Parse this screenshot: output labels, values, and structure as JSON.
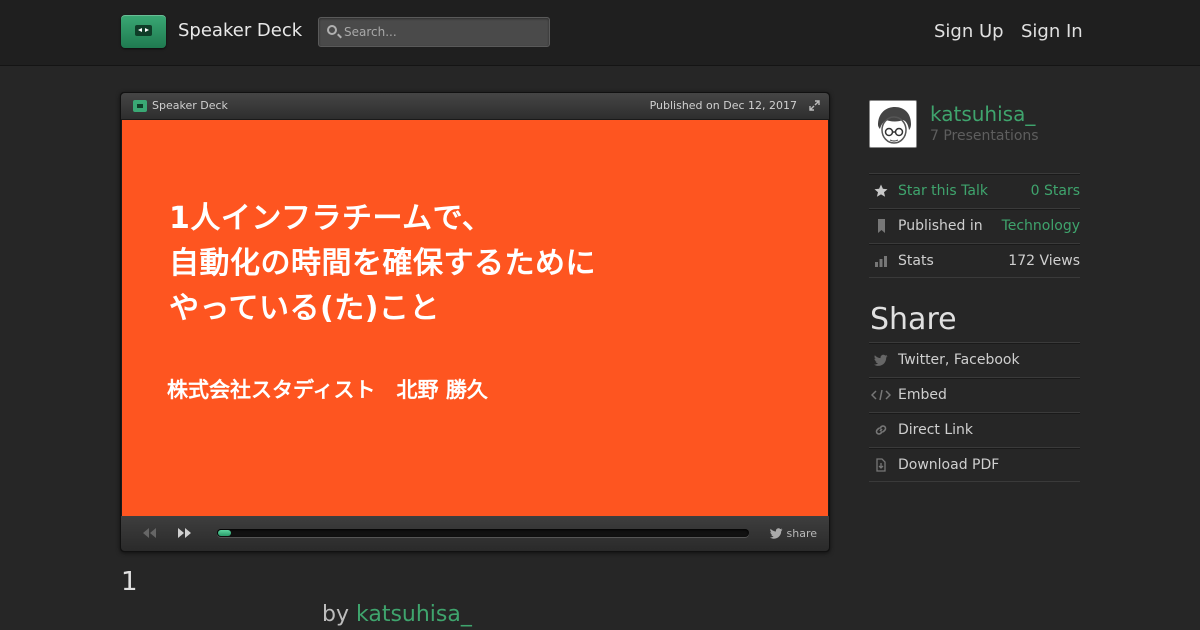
{
  "header": {
    "brand": "Speaker Deck",
    "search_placeholder": "Search...",
    "sign_up": "Sign Up",
    "sign_in": "Sign In"
  },
  "player": {
    "brand": "Speaker Deck",
    "published": "Published on Dec 12, 2017",
    "slide": {
      "title_lines": [
        "1人インフラチームで、",
        "自動化の時間を確保するために",
        "やっている(た)こと"
      ],
      "author": "株式会社スタディスト　北野 勝久",
      "background": "#fe5520"
    },
    "controls": {
      "progress_fraction": 0.025,
      "share_label": "share"
    }
  },
  "below_player": {
    "slide_number": "1",
    "by_prefix": "by",
    "author": "katsuhisa_"
  },
  "sidebar": {
    "author_name": "katsuhisa_",
    "presentations": "7 Presentations",
    "rows": [
      {
        "icon": "star-icon",
        "label": "Star this Talk",
        "value": "0 Stars"
      },
      {
        "icon": "bookmark-icon",
        "label": "Published in",
        "value": "Technology"
      },
      {
        "icon": "bar-chart-icon",
        "label": "Stats",
        "value": "172 Views"
      }
    ],
    "share_heading": "Share",
    "share_rows": [
      {
        "icon": "twitter-bird-icon",
        "label": "Twitter, Facebook"
      },
      {
        "icon": "code-icon",
        "label": "Embed"
      },
      {
        "icon": "link-icon",
        "label": "Direct Link"
      },
      {
        "icon": "download-icon",
        "label": "Download PDF"
      }
    ]
  },
  "colors": {
    "accent_green": "#3fa46d",
    "background": "#262626",
    "slide_orange": "#fe5520"
  }
}
